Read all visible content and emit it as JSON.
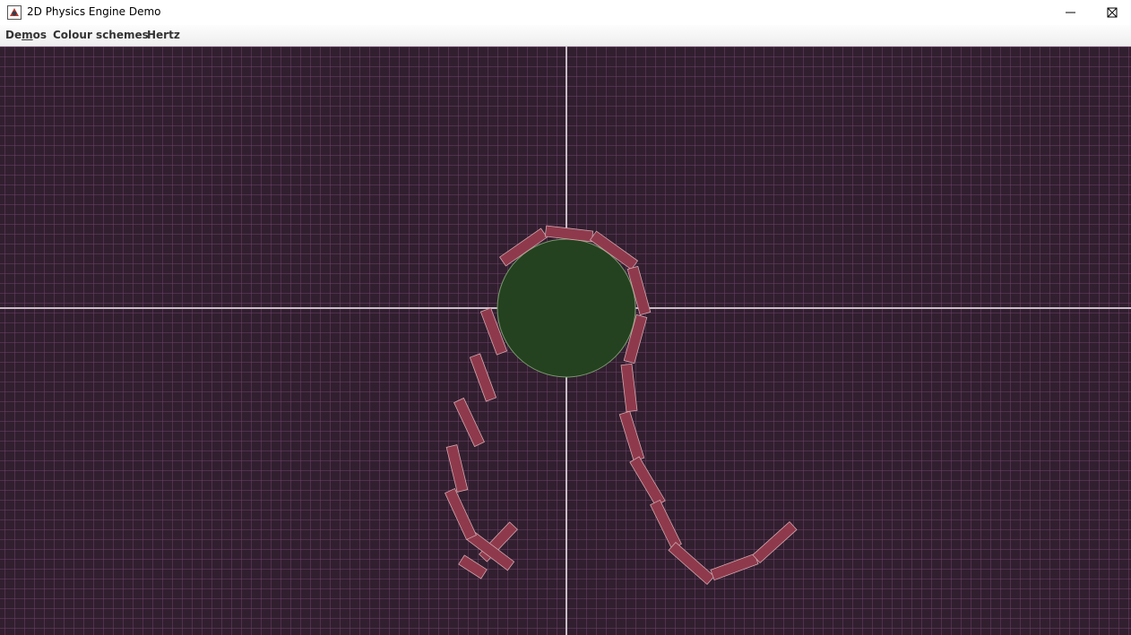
{
  "window": {
    "title": "2D Physics Engine Demo",
    "app_icon": "java-app-icon",
    "controls": [
      "minimize-icon",
      "maximize-icon",
      "close-icon"
    ]
  },
  "menu": {
    "items": [
      {
        "label": "Demos",
        "mnemonic": "m"
      },
      {
        "label": "Colour schemes"
      },
      {
        "label": "Hertz"
      }
    ]
  },
  "scene": {
    "background_color": "#311f2f",
    "grid_color": "#5a3a55",
    "axis_color": "#c9bcc8",
    "ball_color": "#24421f",
    "ball_outline": "#7a9a6e",
    "link_color": "#8f3a4c",
    "link_outline": "#d0a6ae"
  }
}
